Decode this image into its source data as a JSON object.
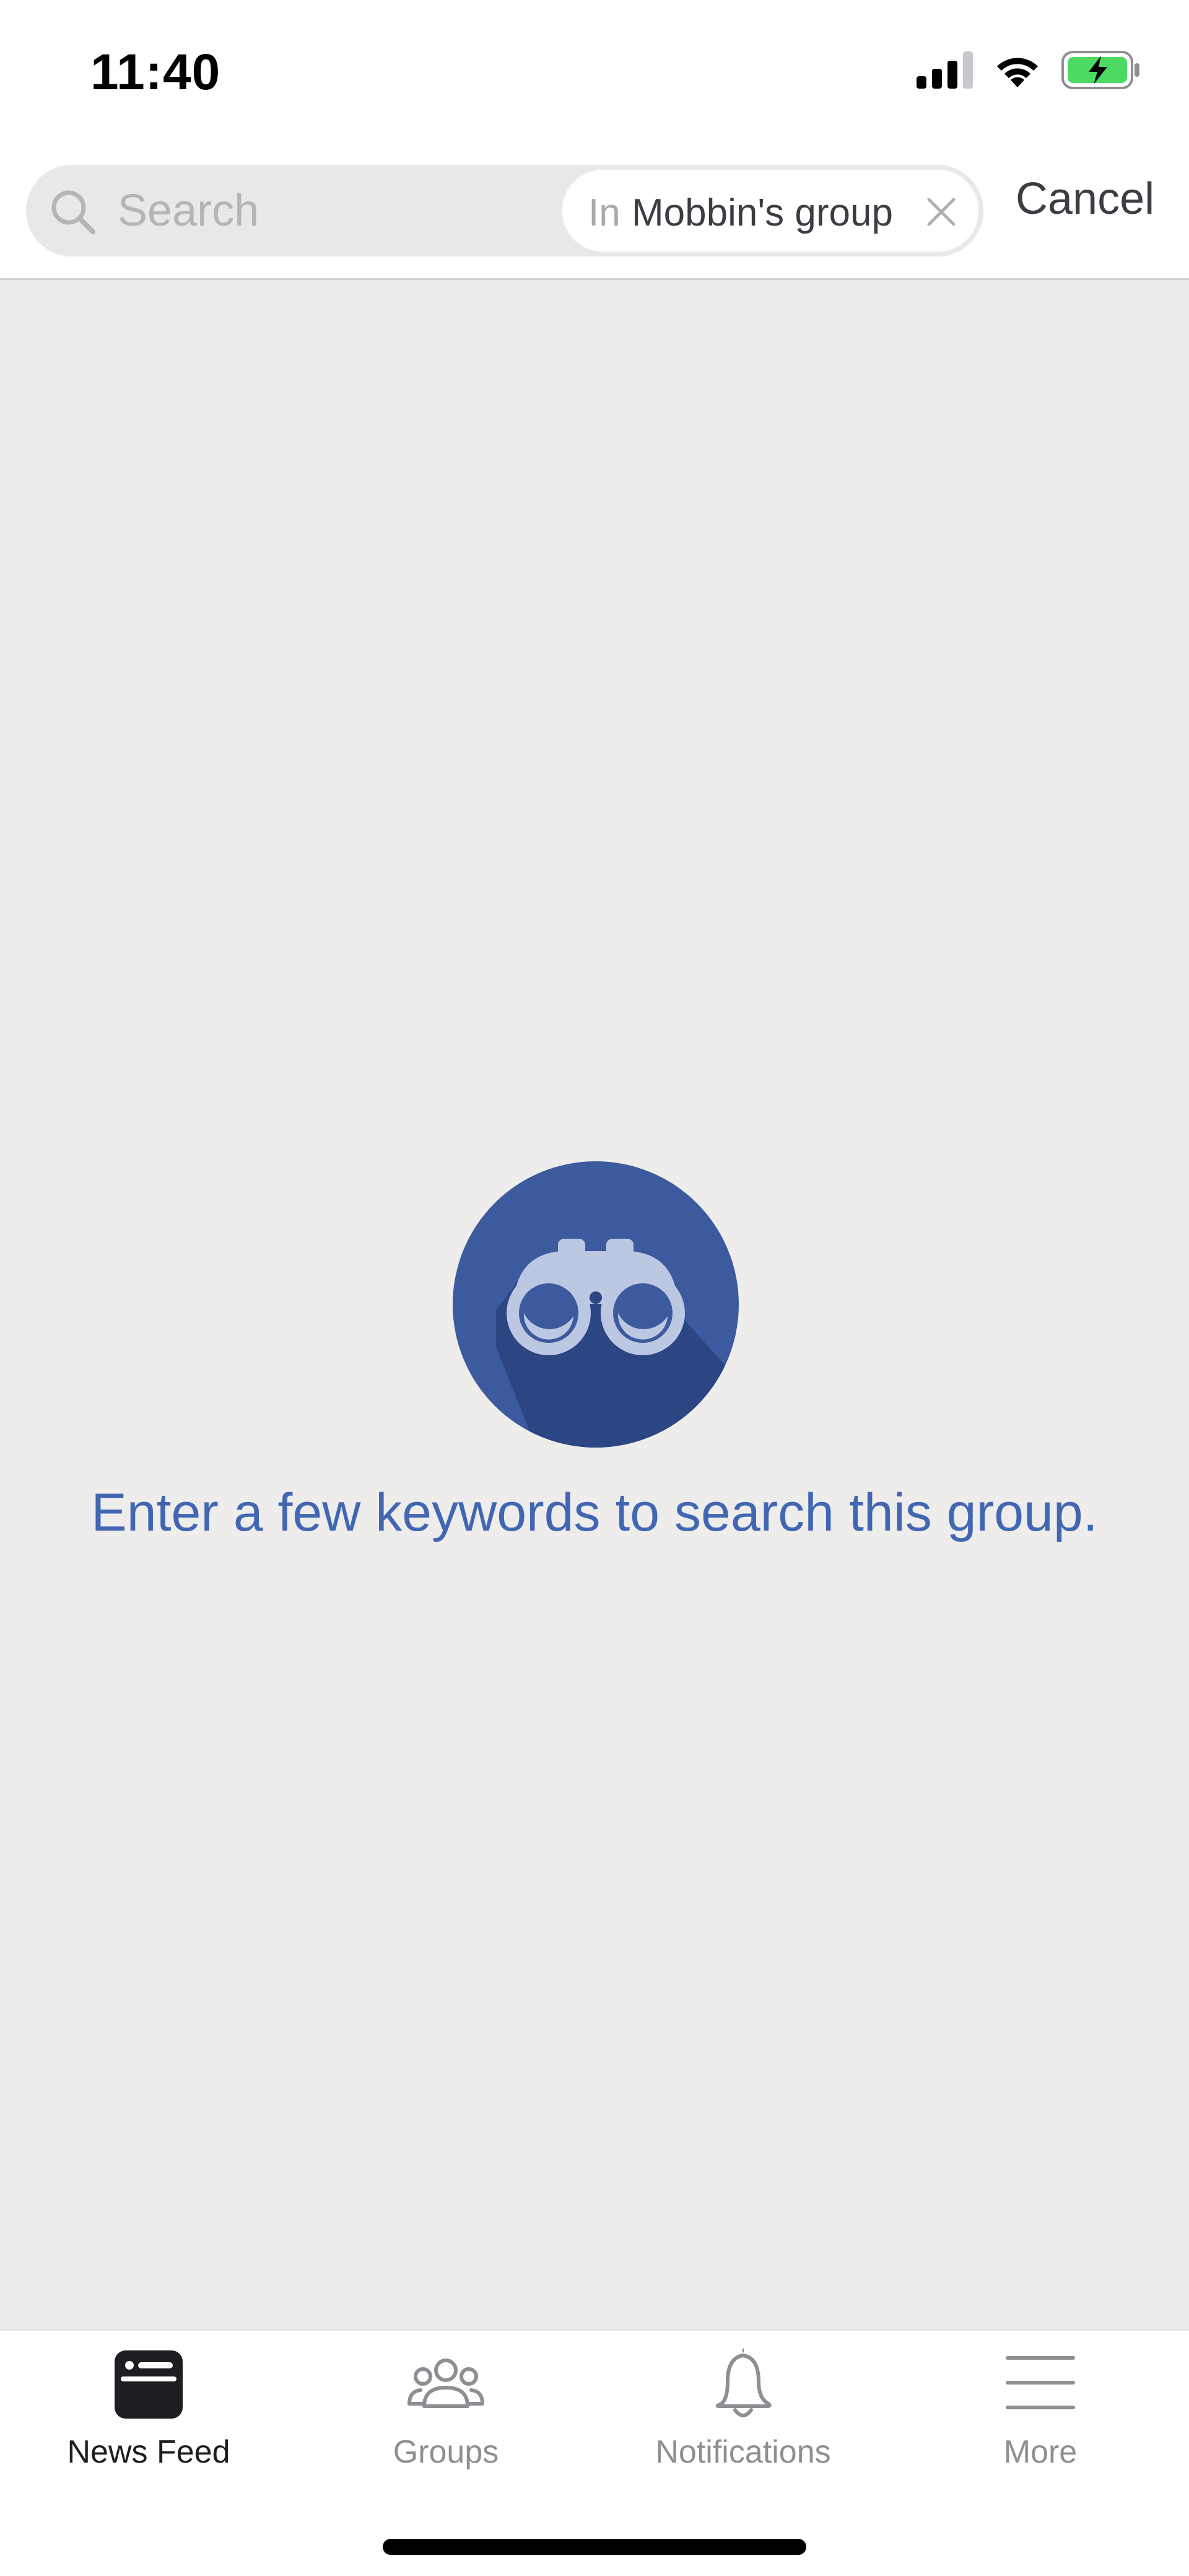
{
  "status_bar": {
    "time": "11:40",
    "icons": [
      "cellular-signal-icon",
      "wifi-icon",
      "battery-charging-icon"
    ]
  },
  "search": {
    "placeholder": "Search",
    "value": "",
    "scope_prefix": "In",
    "scope_name": "Mobbin's group",
    "cancel_label": "Cancel"
  },
  "empty_state": {
    "icon": "binoculars-icon",
    "message": "Enter a few keywords to search this group."
  },
  "tab_bar": {
    "tabs": [
      {
        "label": "News Feed",
        "icon": "news-feed-icon",
        "active": true
      },
      {
        "label": "Groups",
        "icon": "groups-icon",
        "active": false
      },
      {
        "label": "Notifications",
        "icon": "bell-icon",
        "active": false
      },
      {
        "label": "More",
        "icon": "menu-icon",
        "active": false
      }
    ]
  },
  "colors": {
    "accent_blue": "#4267b2",
    "content_background": "#eeedec",
    "inactive_tab": "#8e8e93",
    "battery_green": "#4cd964"
  }
}
